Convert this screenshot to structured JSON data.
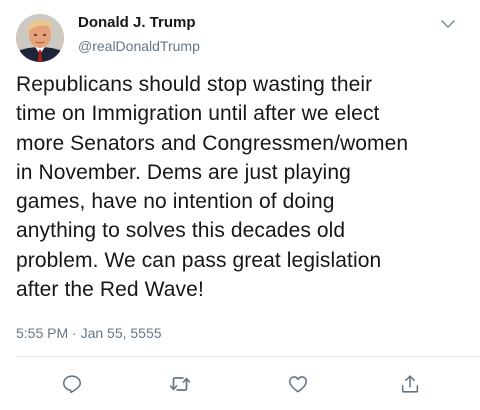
{
  "tweet": {
    "display_name": "Donald J. Trump",
    "handle": "@realDonaldTrump",
    "body_lines": [
      "Republicans should stop wasting their",
      "time on Immigration until after we elect",
      "more Senators and Congressmen/women",
      "in November. Dems are just playing",
      "games, have no intention of doing",
      "anything to solves this decades old",
      "problem. We can pass great legislation",
      "after the Red Wave!"
    ],
    "timestamp": "5:55 PM · Jan 55, 5555"
  },
  "icons": {
    "menu": "chevron-down-icon",
    "reply": "reply-icon",
    "retweet": "retweet-icon",
    "like": "heart-icon",
    "share": "share-icon"
  },
  "colors": {
    "text": "#14171a",
    "secondary": "#657786",
    "divider": "#e1e8ed",
    "icon": "#657786"
  }
}
